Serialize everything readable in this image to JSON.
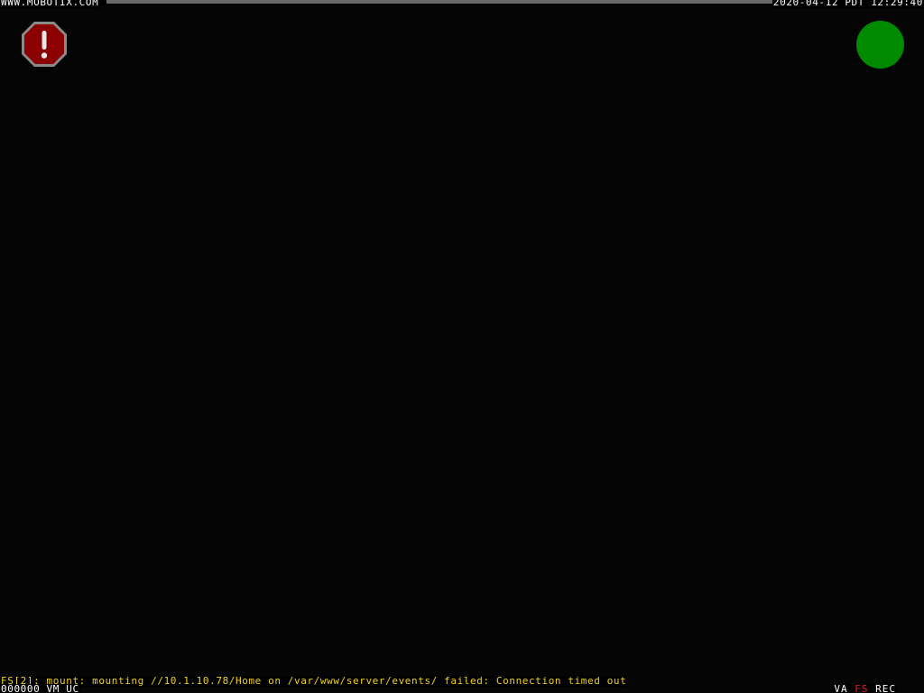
{
  "overlay": {
    "site": "WWW.MOBOTIX.COM",
    "timestamp": "2020-04-12 PDT 12:29:40",
    "error_message": "FS[2]: mount: mounting //10.1.10.78/Home on /var/www/server/events/ failed: Connection timed out",
    "counter": "000000 VM UC",
    "flags": {
      "va": "VA",
      "fs": "FS",
      "rec": "REC"
    }
  },
  "icons": {
    "alert": "stop-sign-exclamation-icon",
    "status": "green-status-dot-icon"
  },
  "colors": {
    "background": "#050505",
    "error_text": "#f2d21c",
    "fs_flag": "#e02020",
    "alert_red": "#8b0000",
    "status_green": "#008a00"
  }
}
